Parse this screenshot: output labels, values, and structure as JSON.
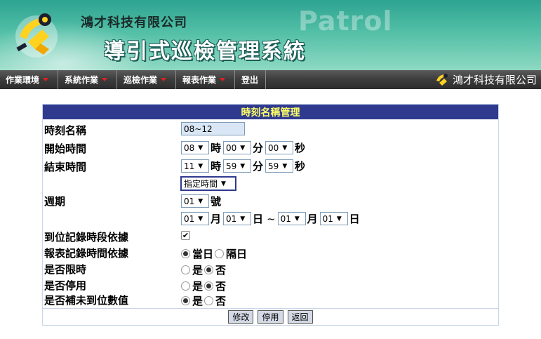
{
  "header": {
    "company_name": "鴻才科技有限公司",
    "system_title": "導引式巡檢管理系統",
    "watermark": "Patrol"
  },
  "nav": {
    "items": [
      {
        "label": "作業環境"
      },
      {
        "label": "系統作業"
      },
      {
        "label": "巡檢作業"
      },
      {
        "label": "報表作業"
      },
      {
        "label": "登出"
      }
    ],
    "brand": "鴻才科技有限公司"
  },
  "form": {
    "title": "時刻名稱管理",
    "name_label": "時刻名稱",
    "name_value": "08~12",
    "start_label": "開始時間",
    "start": {
      "hour": "08",
      "minute": "00",
      "second": "00"
    },
    "end_label": "結束時間",
    "end": {
      "hour": "11",
      "minute": "59",
      "second": "59"
    },
    "units": {
      "hour": "時",
      "minute": "分",
      "second": "秒",
      "month": "月",
      "day": "日",
      "tilde": "~",
      "number": "號"
    },
    "period_mode": "指定時間",
    "cycle_label": "週期",
    "cycle_number": "01",
    "range": {
      "start_month": "01",
      "start_day": "01",
      "end_month": "01",
      "end_day": "01"
    },
    "arrival_label": "到位記錄時段依據",
    "arrival_checked": true,
    "report_label": "報表記錄時間依據",
    "report_options": [
      "當日",
      "隔日"
    ],
    "report_selected": "當日",
    "limit_label": "是否限時",
    "disable_label": "是否停用",
    "fill_label": "是否補未到位數值",
    "yes": "是",
    "no": "否",
    "limit_selected": "否",
    "disable_selected": "否",
    "fill_selected": "是"
  },
  "buttons": {
    "modify": "修改",
    "disable": "停用",
    "back": "返回"
  },
  "colors": {
    "panel_header_bg": "#2f3a8f",
    "panel_header_text": "#ffff66",
    "nav_caret": "#e02020",
    "input_bg": "#d9e6f5"
  }
}
